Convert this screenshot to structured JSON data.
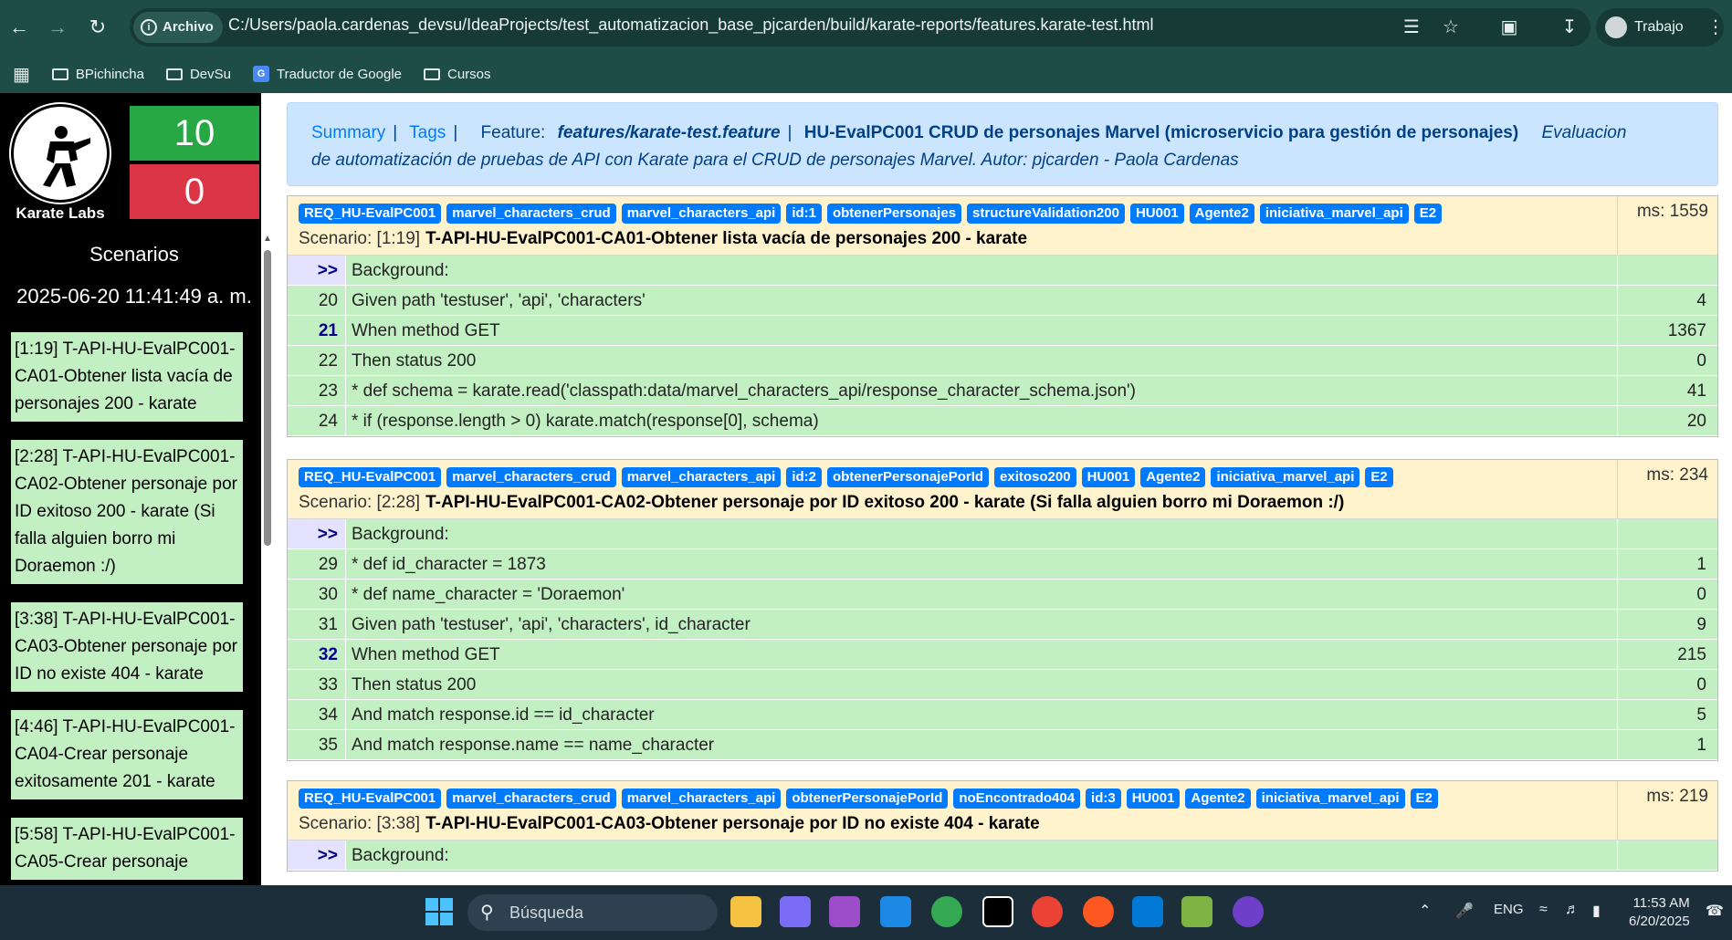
{
  "browser": {
    "site_label": "Archivo",
    "url": "C:/Users/paola.cardenas_devsu/IdeaProjects/test_automatizacion_base_pjcarden/build/karate-reports/features.karate-test.html",
    "profile": "Trabajo",
    "bookmarks": [
      "BPichincha",
      "DevSu",
      "Traductor de Google",
      "Cursos"
    ]
  },
  "sidebar": {
    "logo_text": "Karate Labs",
    "passed": "10",
    "failed": "0",
    "title": "Scenarios",
    "date": "2025-06-20 11:41:49 a. m.",
    "items": [
      "[1:19] T-API-HU-EvalPC001-CA01-Obtener lista vacía de personajes 200 - karate",
      "[2:28] T-API-HU-EvalPC001-CA02-Obtener personaje por ID exitoso 200 - karate (Si falla alguien borro mi Doraemon :/)",
      "[3:38] T-API-HU-EvalPC001-CA03-Obtener personaje por ID no existe 404 - karate",
      "[4:46] T-API-HU-EvalPC001-CA04-Crear personaje exitosamente 201 - karate",
      "[5:58] T-API-HU-EvalPC001-CA05-Crear personaje"
    ]
  },
  "header": {
    "summary": "Summary",
    "tags": "Tags",
    "feature_label": "Feature:",
    "feature_path": "features/karate-test.feature",
    "feature_name": "HU-EvalPC001 CRUD de personajes Marvel (microservicio para gestión de personajes)",
    "description_1": "Evaluacion",
    "description_2": "de automatización de pruebas de API con Karate para el CRUD de personajes Marvel. Autor: pjcarden - Paola Cardenas"
  },
  "scenarios": [
    {
      "tags": [
        "REQ_HU-EvalPC001",
        "marvel_characters_crud",
        "marvel_characters_api",
        "id:1",
        "obtenerPersonajes",
        "structureValidation200",
        "HU001",
        "Agente2",
        "iniciativa_marvel_api",
        "E2"
      ],
      "prefix": "Scenario: [1:19]",
      "name": "T-API-HU-EvalPC001-CA01-Obtener lista vacía de personajes 200 - karate",
      "ms": "ms: 1559",
      "steps": [
        {
          "ln": ">>",
          "text": "Background:",
          "ms": ""
        },
        {
          "ln": "20",
          "text": "Given path 'testuser', 'api', 'characters'",
          "ms": "4"
        },
        {
          "ln": "21",
          "text": "When method GET",
          "ms": "1367"
        },
        {
          "ln": "22",
          "text": "Then status 200",
          "ms": "0"
        },
        {
          "ln": "23",
          "text": "* def schema = karate.read('classpath:data/marvel_characters_api/response_character_schema.json')",
          "ms": "41"
        },
        {
          "ln": "24",
          "text": "* if (response.length > 0) karate.match(response[0], schema)",
          "ms": "20"
        }
      ]
    },
    {
      "tags": [
        "REQ_HU-EvalPC001",
        "marvel_characters_crud",
        "marvel_characters_api",
        "id:2",
        "obtenerPersonajePorId",
        "exitoso200",
        "HU001",
        "Agente2",
        "iniciativa_marvel_api",
        "E2"
      ],
      "prefix": "Scenario: [2:28]",
      "name": "T-API-HU-EvalPC001-CA02-Obtener personaje por ID exitoso 200 - karate (Si falla alguien borro mi Doraemon :/)",
      "ms": "ms: 234",
      "steps": [
        {
          "ln": ">>",
          "text": "Background:",
          "ms": ""
        },
        {
          "ln": "29",
          "text": "* def id_character = 1873",
          "ms": "1"
        },
        {
          "ln": "30",
          "text": "* def name_character = 'Doraemon'",
          "ms": "0"
        },
        {
          "ln": "31",
          "text": "Given path 'testuser', 'api', 'characters', id_character",
          "ms": "9"
        },
        {
          "ln": "32",
          "text": "When method GET",
          "ms": "215"
        },
        {
          "ln": "33",
          "text": "Then status 200",
          "ms": "0"
        },
        {
          "ln": "34",
          "text": "And match response.id == id_character",
          "ms": "5"
        },
        {
          "ln": "35",
          "text": "And match response.name == name_character",
          "ms": "1"
        }
      ]
    },
    {
      "tags": [
        "REQ_HU-EvalPC001",
        "marvel_characters_crud",
        "marvel_characters_api",
        "obtenerPersonajePorId",
        "noEncontrado404",
        "id:3",
        "HU001",
        "Agente2",
        "iniciativa_marvel_api",
        "E2"
      ],
      "prefix": "Scenario: [3:38]",
      "name": "T-API-HU-EvalPC001-CA03-Obtener personaje por ID no existe 404 - karate",
      "ms": "ms: 219",
      "steps": [
        {
          "ln": ">>",
          "text": "Background:",
          "ms": ""
        }
      ]
    }
  ],
  "taskbar": {
    "search": "Búsqueda",
    "lang": "ENG",
    "time": "11:53 AM",
    "date": "6/20/2025"
  }
}
